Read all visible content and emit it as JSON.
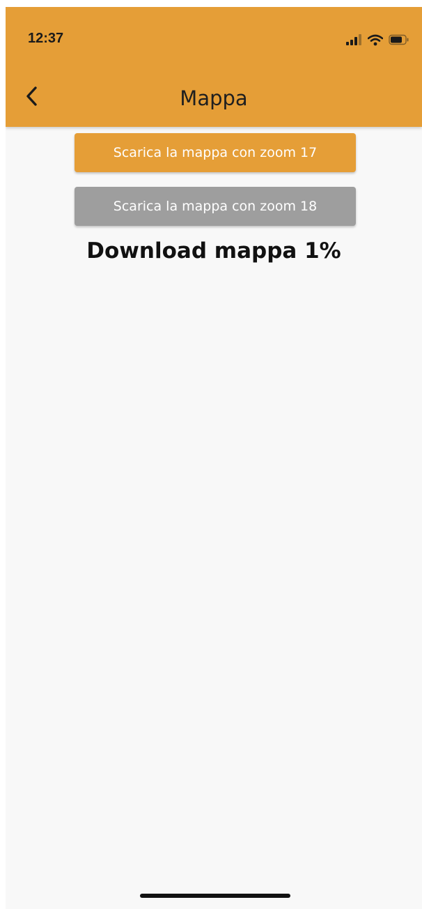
{
  "status_bar": {
    "time": "12:37",
    "icons": [
      "cellular-signal-icon",
      "wifi-icon",
      "battery-icon"
    ]
  },
  "nav": {
    "back_icon": "chevron-left-icon",
    "title": "Mappa"
  },
  "actions": {
    "zoom17_label": "Scarica la mappa con zoom 17",
    "zoom18_label": "Scarica la mappa con zoom 18"
  },
  "download": {
    "status_text": "Download mappa 1%",
    "progress_percent": 1
  },
  "colors": {
    "header_bg": "#e59e37",
    "primary_button": "#e59e37",
    "disabled_button": "#9e9e9e",
    "background": "#f8f8f8"
  }
}
